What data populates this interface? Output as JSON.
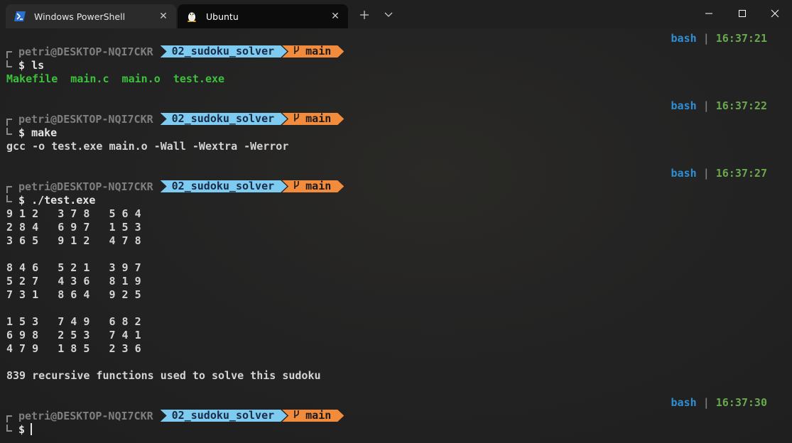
{
  "window": {
    "tabs": [
      {
        "label": "Windows PowerShell",
        "icon": "powershell-icon",
        "active": false
      },
      {
        "label": "Ubuntu",
        "icon": "linux-tux-icon",
        "active": true
      }
    ],
    "new_tab_icon": "plus-icon",
    "dropdown_icon": "chevron-down-icon",
    "controls": [
      "minimize-icon",
      "maximize-icon",
      "close-icon"
    ]
  },
  "colors": {
    "terminal_bg": "#232323",
    "dir_segment": "#7ecbf2",
    "git_segment": "#f28b3c",
    "shell_label": "#2e8fd4",
    "time_label": "#6aa84f",
    "ls_output": "#3cc13c"
  },
  "prompt": {
    "user_host": "petri@DESKTOP-NQI7CKR",
    "directory": "02_sudoku_solver",
    "branch": "main",
    "branch_icon": "git-branch-icon",
    "symbol": "$"
  },
  "blocks": [
    {
      "shell": "bash",
      "sep": "|",
      "time": "16:37:21",
      "command": "ls",
      "output": [
        "Makefile  main.c  main.o  test.exe"
      ]
    },
    {
      "shell": "bash",
      "sep": "|",
      "time": "16:37:22",
      "command": "make",
      "output": [
        "gcc -o test.exe main.o -Wall -Wextra -Werror"
      ]
    },
    {
      "shell": "bash",
      "sep": "|",
      "time": "16:37:27",
      "command": "./test.exe",
      "output": [
        "9 1 2   3 7 8   5 6 4",
        "2 8 4   6 9 7   1 5 3",
        "3 6 5   9 1 2   4 7 8",
        "",
        "8 4 6   5 2 1   3 9 7",
        "5 2 7   4 3 6   8 1 9",
        "7 3 1   8 6 4   9 2 5",
        "",
        "1 5 3   7 4 9   6 8 2",
        "6 9 8   2 5 3   7 4 1",
        "4 7 9   1 8 5   2 3 6",
        "",
        "839 recursive functions used to solve this sudoku"
      ]
    },
    {
      "shell": "bash",
      "sep": "|",
      "time": "16:37:30",
      "command": "",
      "output": []
    }
  ]
}
